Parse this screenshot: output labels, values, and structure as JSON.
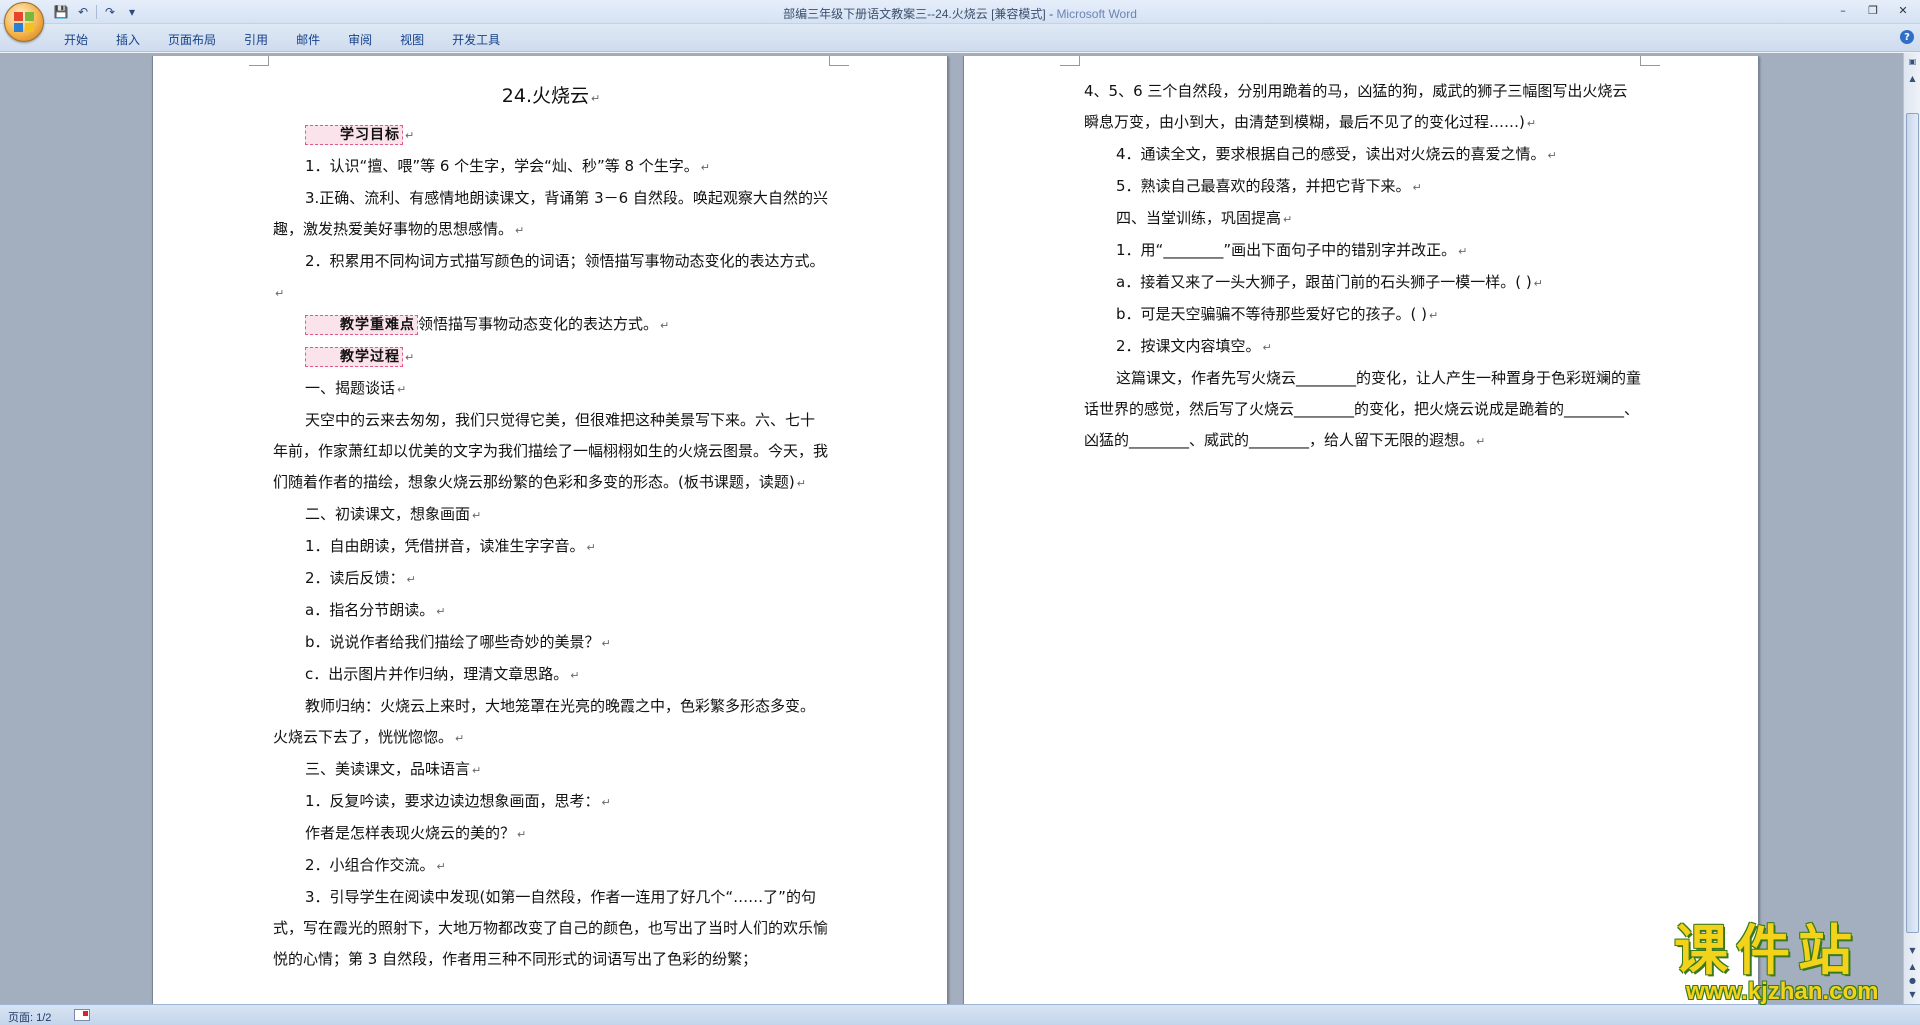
{
  "window": {
    "title_doc": "部编三年级下册语文教案三--24.火烧云 [兼容模式] - ",
    "title_app": "Microsoft Word",
    "controls": [
      "–",
      "❐",
      "✕"
    ]
  },
  "quick_access": {
    "save_icon": "💾",
    "undo_icon": "↶",
    "redo_icon": "↷",
    "customize_icon": "▾"
  },
  "ribbon": {
    "tabs": [
      "开始",
      "插入",
      "页面布局",
      "引用",
      "邮件",
      "审阅",
      "视图",
      "开发工具"
    ],
    "help": "?"
  },
  "page1": {
    "title": "24.火烧云",
    "section_goal": "学习目标",
    "goal_1": "1．认识“擅、喂”等 6 个生字，学会“灿、秒”等 8 个生字。",
    "goal_3": "3.正确、流利、有感情地朗读课文，背诵第 3－6 自然段。唤起观察大自然的兴趣，激发热爱美好事物的思想感情。",
    "goal_2": "2．积累用不同构词方式描写颜色的词语；领悟描写事物动态变化的表达方式。",
    "section_key": "教学重难点",
    "key_text": "领悟描写事物动态变化的表达方式。",
    "section_process": "教学过程",
    "step1_title": "一、揭题谈话",
    "step1_text": "天空中的云来去匆匆，我们只觉得它美，但很难把这种美景写下来。六、七十年前，作家萧红却以优美的文字为我们描绘了一幅栩栩如生的火烧云图景。今天，我们随着作者的描绘，想象火烧云那纷繁的色彩和多变的形态。(板书课题，读题)",
    "step2_title": "二、初读课文，想象画面",
    "step2_1": "1．自由朗读，凭借拼音，读准生字字音。",
    "step2_2": "2．读后反馈：",
    "step2_a": "a．指名分节朗读。",
    "step2_b": "b．说说作者给我们描绘了哪些奇妙的美景？",
    "step2_c": "c．出示图片并作归纳，理清文章思路。",
    "teacher_summary": "教师归纳：火烧云上来时，大地笼罩在光亮的晚霞之中，色彩繁多形态多变。火烧云下去了，恍恍惚惚。",
    "step3_title": "三、美读课文，品味语言",
    "step3_1": "1．反复吟读，要求边读边想象画面，思考：",
    "step3_q": "作者是怎样表现火烧云的美的？",
    "step3_2": "2．小组合作交流。",
    "step3_3": "3．引导学生在阅读中发现(如第一自然段，作者一连用了好几个“……了”的句式，写在霞光的照射下，大地万物都改变了自己的颜色，也写出了当时人们的欢乐愉悦的心情；第 3 自然段，作者用三种不同形式的词语写出了色彩的纷繁；"
  },
  "page2": {
    "cont": "4、5、6 三个自然段，分别用跪着的马，凶猛的狗，威武的狮子三幅图写出火烧云瞬息万变，由小到大，由清楚到模糊，最后不见了的变化过程……)",
    "item4": "4．通读全文，要求根据自己的感受，读出对火烧云的喜爱之情。",
    "item5": "5．熟读自己最喜欢的段落，并把它背下来。",
    "step4_title": "四、当堂训练，巩固提高",
    "ex1": "1．用“________”画出下面句子中的错别字并改正。",
    "ex1_a": "a．接着又来了一头大狮子，跟苗门前的石头狮子一模一样。(      )",
    "ex1_b": "b．可是天空骗骗不等待那些爱好它的孩子。(      )",
    "ex2": "2．按课文内容填空。",
    "ex2_text": "这篇课文，作者先写火烧云________的变化，让人产生一种置身于色彩斑斓的童话世界的感觉，然后写了火烧云________的变化，把火烧云说成是跪着的________、凶猛的________、威武的________，给人留下无限的遐想。"
  },
  "status": {
    "page_indicator": "页面: 1/2"
  },
  "watermark": {
    "cn": "课件站",
    "en": "www.kjzhan.com"
  },
  "colors": {
    "workspace_bg": "#a3aebf",
    "heading_highlight": "#fbe3ec",
    "ribbon_text": "#15428b"
  }
}
